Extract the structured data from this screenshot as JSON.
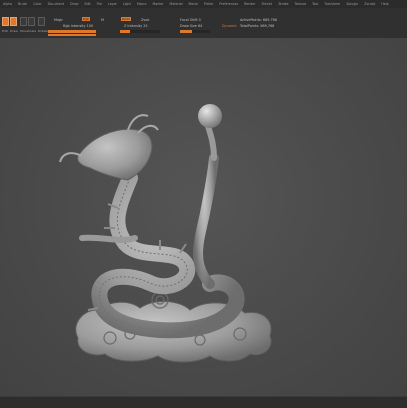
{
  "menu": {
    "items": [
      "Alpha",
      "Brush",
      "Color",
      "Document",
      "Draw",
      "Edit",
      "File",
      "Layer",
      "Light",
      "Macro",
      "Marker",
      "Material",
      "Movie",
      "Picker",
      "Preferences",
      "Render",
      "Stencil",
      "Stroke",
      "Texture",
      "Tool",
      "Transform",
      "Zplugin",
      "Zscript",
      "Help"
    ]
  },
  "toolbar": {
    "buttons": [
      {
        "label": "Edit",
        "icon": "edit-icon",
        "active": true
      },
      {
        "label": "Draw",
        "icon": "draw-icon",
        "active": true
      },
      {
        "label": "Move",
        "icon": "move-icon",
        "active": false
      },
      {
        "label": "Scale",
        "icon": "scale-icon",
        "active": false
      },
      {
        "label": "Rotate",
        "icon": "rotate-icon",
        "active": false
      }
    ],
    "mrgb_label": "Mrgb",
    "rgb_label": "Rgb",
    "m_label": "M",
    "rgb_intensity_label": "Rgb Intensity 100",
    "zadd_label": "Zadd",
    "zsub_label": "Zsub",
    "z_intensity_label": "Z Intensity 25",
    "focal_shift_label": "Focal Shift 0",
    "draw_size_label": "Draw Size 64",
    "dynamic_label": "Dynamic",
    "active_points_label": "ActivePoints: 689,768",
    "total_points_label": "TotalPoints: 689,768"
  },
  "colors": {
    "accent": "#e0782a",
    "background": "#4a4a4a",
    "panel": "#303030",
    "model": "#9c9c9c"
  },
  "viewport": {
    "model_name": "dragon-sculpture-icon"
  }
}
